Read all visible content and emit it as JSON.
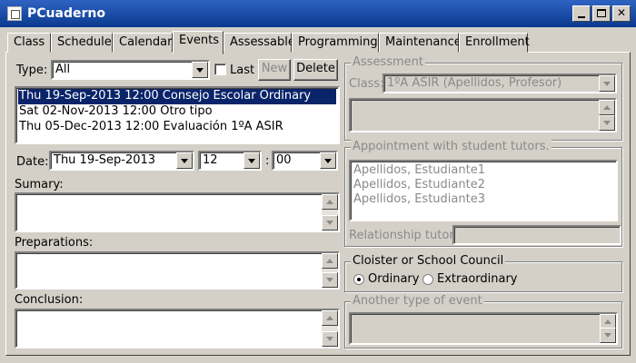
{
  "window": {
    "title": "PCuaderno"
  },
  "tabs": [
    "Class",
    "Schedule",
    "Calendar",
    "Events",
    "Assessable",
    "Programming",
    "Maintenance",
    "Enrollment"
  ],
  "active_tab": "Events",
  "events": {
    "type_label": "Type:",
    "type_value": "All",
    "last_label": "Last",
    "new_label": "New",
    "delete_label": "Delete",
    "list": [
      "Thu 19-Sep-2013 12:00  Consejo Escolar Ordinary",
      "Sat 02-Nov-2013 12:00  Otro tipo",
      "Thu 05-Dec-2013 12:00  Evaluación 1ºA ASIR"
    ],
    "selected_index": 0,
    "date_label": "Date:",
    "date_value": "Thu 19-Sep-2013",
    "hour_value": "12",
    "time_separator": ":",
    "minute_value": "00",
    "summary_label": "Sumary:",
    "preparations_label": "Preparations:",
    "conclusion_label": "Conclusion:"
  },
  "assessment": {
    "title": "Assessment",
    "class_label": "Class:",
    "class_value": "1ºA ASIR (Apellidos, Profesor)"
  },
  "appointment": {
    "title": "Appointment with student tutors.",
    "students": [
      "Apellidos, Estudiante1",
      "Apellidos, Estudiante2",
      "Apellidos, Estudiante3"
    ],
    "relationship_label": "Relationship tutor:"
  },
  "cloister": {
    "title": "Cloister or School Council",
    "ordinary_label": "Ordinary",
    "extraordinary_label": "Extraordinary",
    "selected": "Ordinary"
  },
  "another": {
    "title": "Another type of event"
  }
}
